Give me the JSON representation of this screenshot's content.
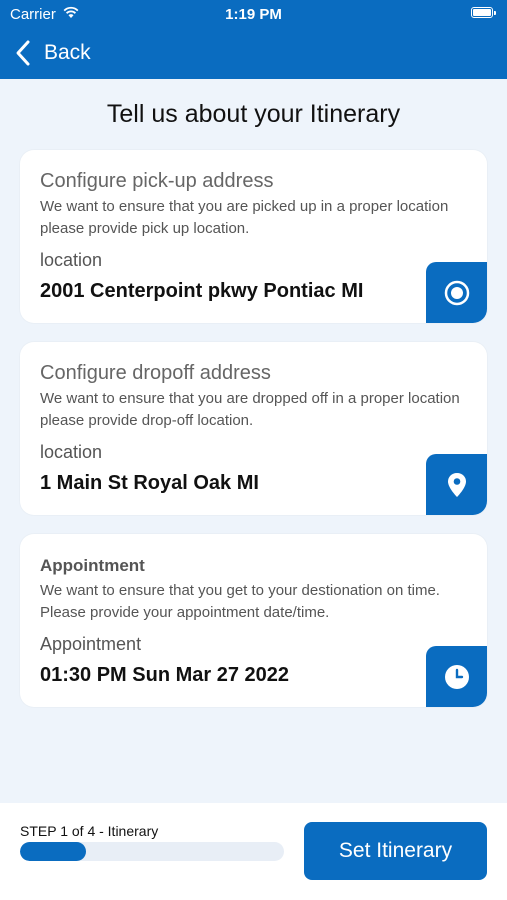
{
  "status_bar": {
    "carrier": "Carrier",
    "time": "1:19 PM"
  },
  "nav": {
    "back_label": "Back"
  },
  "page": {
    "title": "Tell us about your Itinerary"
  },
  "cards": [
    {
      "heading": "Configure pick-up address",
      "description": "We want to ensure that you are picked up in a proper location please provide pick up location.",
      "field_label": "location",
      "field_value": "2001 Centerpoint pkwy Pontiac MI",
      "icon": "target-icon"
    },
    {
      "heading": "Configure dropoff address",
      "description": "We want to ensure that you are dropped off in a proper location please provide drop-off location.",
      "field_label": "location",
      "field_value": "1 Main St Royal Oak MI",
      "icon": "map-pin-icon"
    },
    {
      "heading": "Appointment",
      "description": "We want to ensure that you get to your destionation on time. Please provide your appointment date/time.",
      "field_label": "Appointment",
      "field_value": "01:30 PM Sun Mar 27 2022",
      "icon": "clock-icon"
    }
  ],
  "footer": {
    "step_text": "STEP 1 of 4 - Itinerary",
    "progress": 0.25,
    "button_label": "Set Itinerary"
  },
  "colors": {
    "primary": "#0a6cc0",
    "background": "#eef4fb"
  }
}
